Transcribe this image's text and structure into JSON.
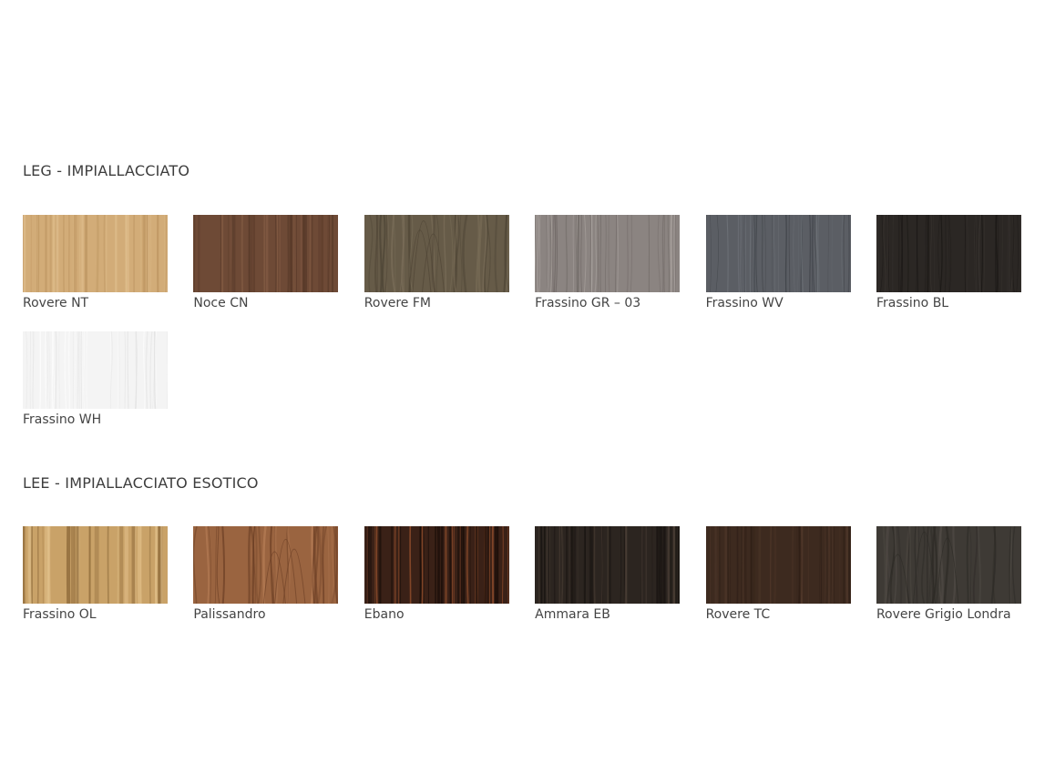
{
  "sections": [
    {
      "title": "LEG - IMPIALLACCIATO",
      "items": [
        {
          "label": "Rovere NT",
          "base": "#d2ac78",
          "grain": "#b8905c",
          "light": "#e2c291",
          "style": "fine"
        },
        {
          "label": "Noce CN",
          "base": "#6e4a36",
          "grain": "#4e3223",
          "light": "#8a6148",
          "style": "fine"
        },
        {
          "label": "Rovere FM",
          "base": "#665b48",
          "grain": "#4c4334",
          "light": "#7a6e59",
          "style": "cathedral"
        },
        {
          "label": "Frassino GR – 03",
          "base": "#8b8481",
          "grain": "#6e6764",
          "light": "#b5aeaa",
          "style": "ash"
        },
        {
          "label": "Frassino WV",
          "base": "#5b5e64",
          "grain": "#3f4247",
          "light": "#70747a",
          "style": "ash"
        },
        {
          "label": "Frassino BL",
          "base": "#2b2724",
          "grain": "#1a1715",
          "light": "#3c3733",
          "style": "ash"
        },
        {
          "label": "Frassino WH",
          "base": "#f4f4f4",
          "grain": "#e2e2e2",
          "light": "#ffffff",
          "style": "ash"
        }
      ]
    },
    {
      "title": "LEE - IMPIALLACCIATO ESOTICO",
      "items": [
        {
          "label": "Frassino OL",
          "base": "#c9a268",
          "grain": "#8e6a3a",
          "light": "#e1c08a",
          "style": "olive"
        },
        {
          "label": "Palissandro",
          "base": "#9a6440",
          "grain": "#6b3e24",
          "light": "#b57c55",
          "style": "cathedral"
        },
        {
          "label": "Ebano",
          "base": "#3a2117",
          "grain": "#1c0f0a",
          "light": "#8a4a2a",
          "style": "stripe"
        },
        {
          "label": "Ammara EB",
          "base": "#2c2520",
          "grain": "#1b1613",
          "light": "#4a3e35",
          "style": "stripe"
        },
        {
          "label": "Rovere TC",
          "base": "#3d2a1f",
          "grain": "#2a1c14",
          "light": "#553c2d",
          "style": "fine"
        },
        {
          "label": "Rovere Grigio Londra",
          "base": "#3e3a35",
          "grain": "#2c2925",
          "light": "#514c46",
          "style": "cathedral"
        }
      ]
    }
  ]
}
